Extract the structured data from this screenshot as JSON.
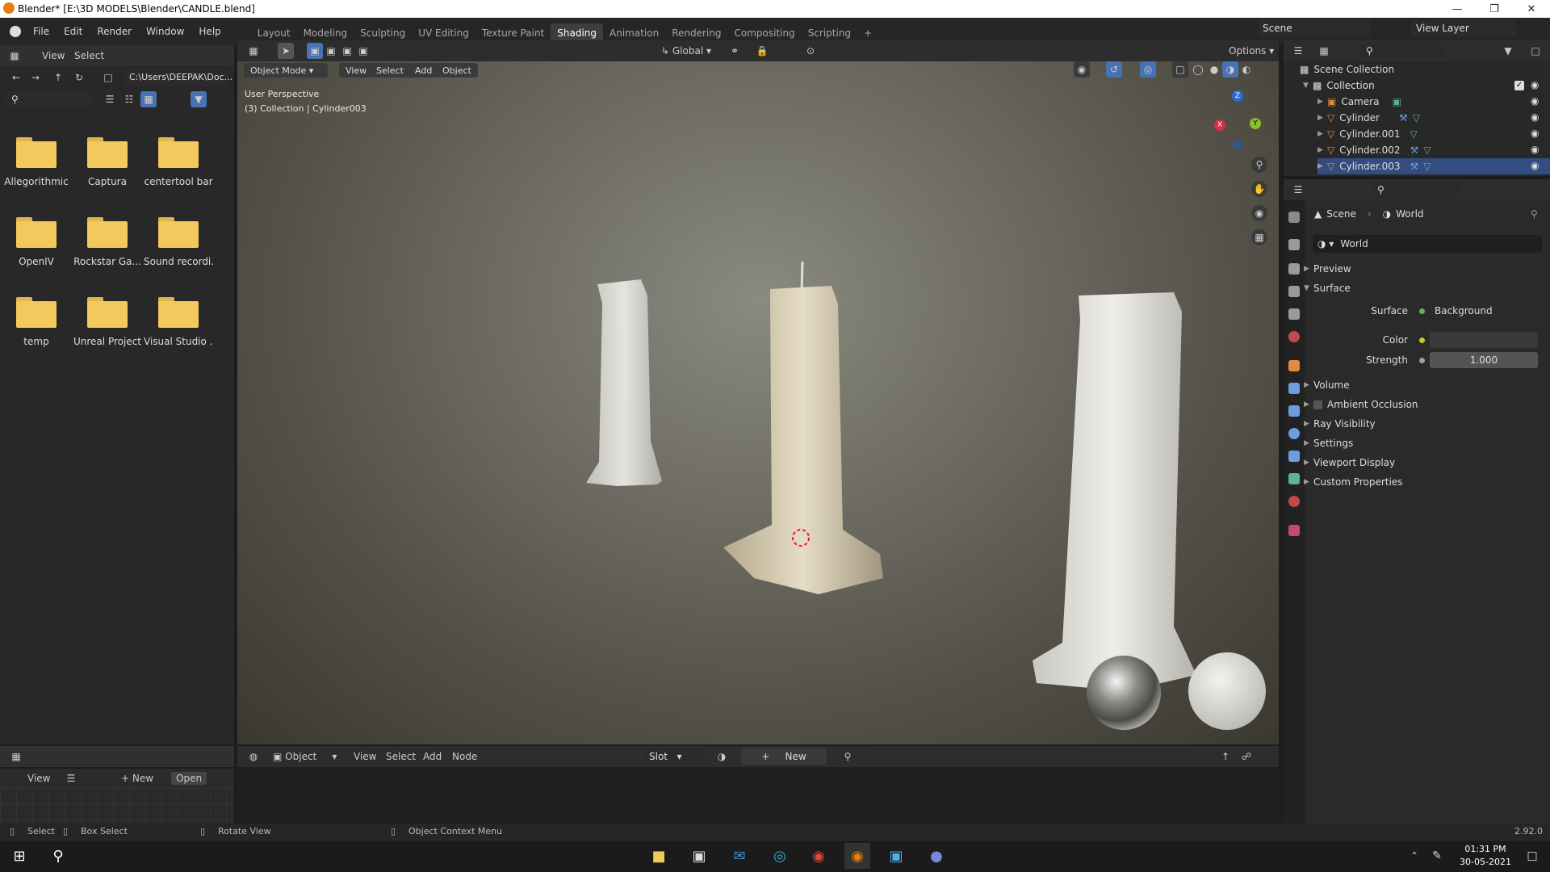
{
  "window": {
    "title": "Blender* [E:\\3D MODELS\\Blender\\CANDLE.blend]"
  },
  "menu": {
    "items": [
      "File",
      "Edit",
      "Render",
      "Window",
      "Help"
    ]
  },
  "workspaces": [
    "Layout",
    "Modeling",
    "Sculpting",
    "UV Editing",
    "Texture Paint",
    "Shading",
    "Animation",
    "Rendering",
    "Compositing",
    "Scripting"
  ],
  "active_workspace": "Shading",
  "scene": {
    "label": "Scene",
    "view_layer": "View Layer"
  },
  "file_browser": {
    "path": "C:\\Users\\DEEPAK\\Doc...",
    "search_placeholder": "",
    "folders": [
      "Allegorithmic",
      "Captura",
      "centertool bar",
      "OpenIV",
      "Rockstar Ga...",
      "Sound recordi...",
      "temp",
      "Unreal Project",
      "Visual Studio ..."
    ]
  },
  "viewport_header": {
    "mode": "Object Mode",
    "menus": [
      "View",
      "Select",
      "Add",
      "Object"
    ],
    "transform": "Global",
    "options": "Options"
  },
  "viewport": {
    "perspective": "User Perspective",
    "collection_info": "(3) Collection | Cylinder003",
    "axes": {
      "x": "X",
      "y": "Y",
      "z": "Z"
    }
  },
  "node_editor": {
    "type": "Object",
    "menus": [
      "View",
      "Select",
      "Add",
      "Node"
    ],
    "slot": "Slot",
    "new_label": "New"
  },
  "image_editor": {
    "view": "View",
    "new": "New",
    "open": "Open"
  },
  "outliner": {
    "root": "Scene Collection",
    "collection": "Collection",
    "items": [
      "Camera",
      "Cylinder",
      "Cylinder.001",
      "Cylinder.002",
      "Cylinder.003"
    ]
  },
  "properties": {
    "breadcrumb": [
      "Scene",
      "World"
    ],
    "world_name": "World",
    "panels": [
      "Preview",
      "Surface",
      "Volume",
      "Ambient Occlusion",
      "Ray Visibility",
      "Settings",
      "Viewport Display",
      "Custom Properties"
    ],
    "surface_label": "Surface",
    "surface_value": "Background",
    "color_label": "Color",
    "strength_label": "Strength",
    "strength_value": "1.000"
  },
  "statusbar": {
    "select": "Select",
    "box_select": "Box Select",
    "rotate": "Rotate View",
    "context": "Object Context Menu",
    "version": "2.92.0"
  },
  "taskbar": {
    "time": "01:31 PM",
    "date": "30-05-2021"
  }
}
